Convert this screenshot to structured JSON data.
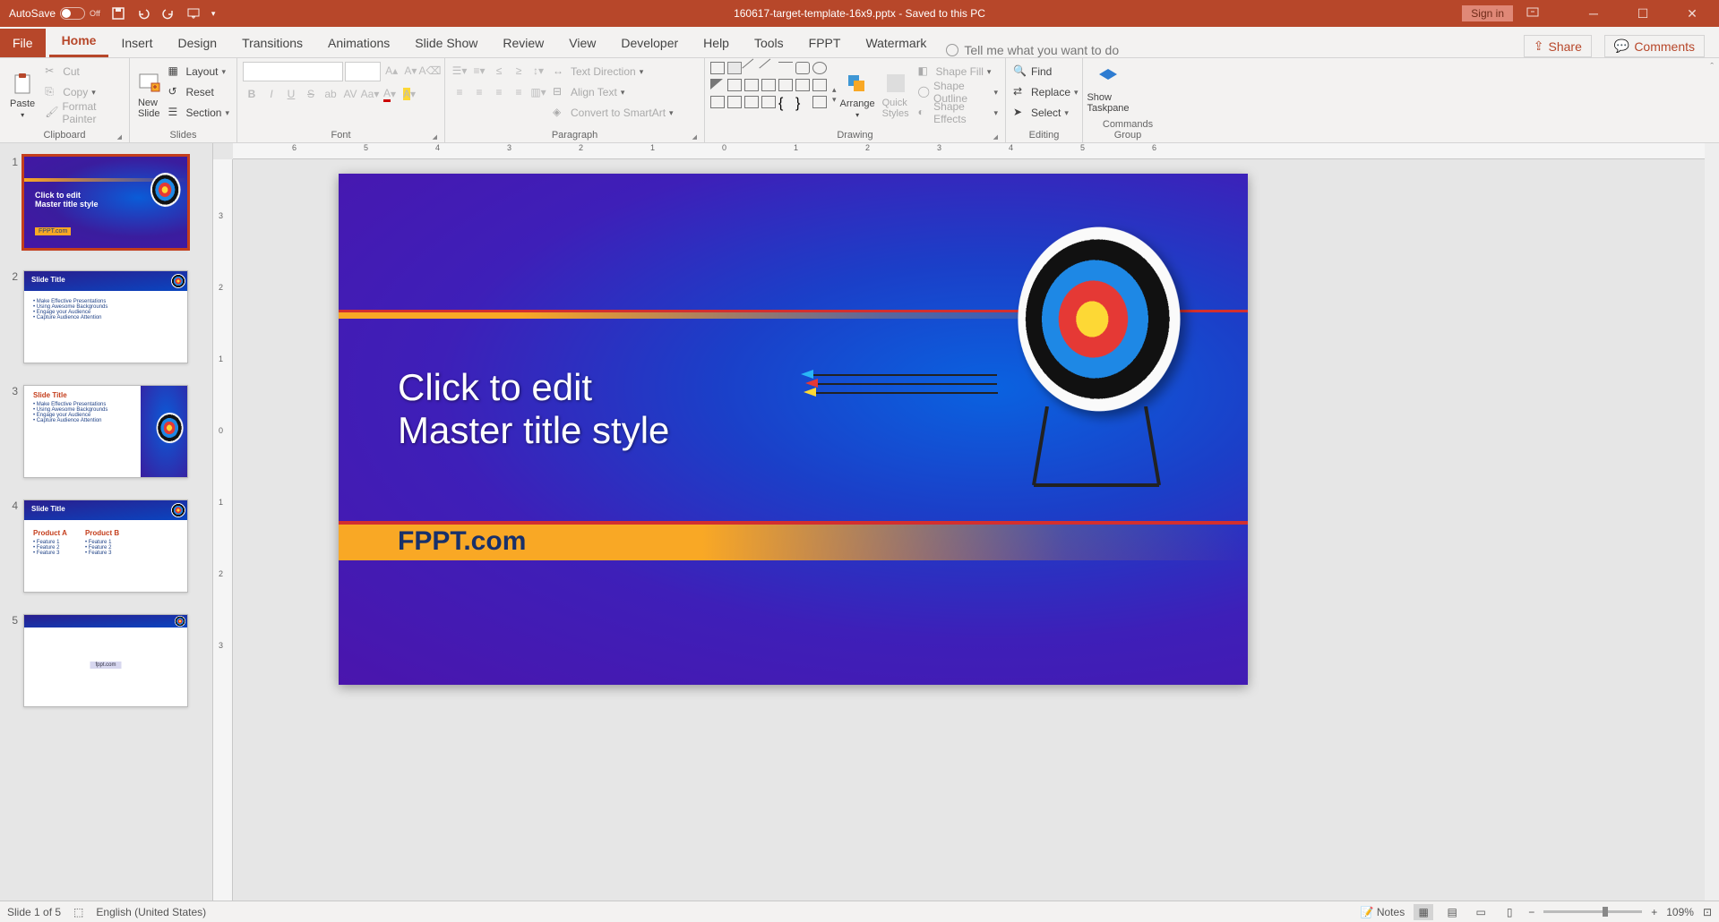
{
  "titlebar": {
    "autosave": "AutoSave",
    "autosave_state": "Off",
    "filename": "160617-target-template-16x9.pptx - Saved to this PC",
    "signin": "Sign in"
  },
  "tabs": {
    "file": "File",
    "items": [
      "Home",
      "Insert",
      "Design",
      "Transitions",
      "Animations",
      "Slide Show",
      "Review",
      "View",
      "Developer",
      "Help",
      "Tools",
      "FPPT",
      "Watermark"
    ],
    "active_index": 0,
    "tellme": "Tell me what you want to do",
    "share": "Share",
    "comments": "Comments"
  },
  "ribbon": {
    "clipboard": {
      "label": "Clipboard",
      "paste": "Paste",
      "cut": "Cut",
      "copy": "Copy",
      "format_painter": "Format Painter"
    },
    "slides": {
      "label": "Slides",
      "new_slide": "New\nSlide",
      "layout": "Layout",
      "reset": "Reset",
      "section": "Section"
    },
    "font": {
      "label": "Font"
    },
    "paragraph": {
      "label": "Paragraph",
      "text_direction": "Text Direction",
      "align_text": "Align Text",
      "convert_smartart": "Convert to SmartArt"
    },
    "drawing": {
      "label": "Drawing",
      "arrange": "Arrange",
      "quick_styles": "Quick\nStyles",
      "shape_fill": "Shape Fill",
      "shape_outline": "Shape Outline",
      "shape_effects": "Shape Effects"
    },
    "editing": {
      "label": "Editing",
      "find": "Find",
      "replace": "Replace",
      "select": "Select"
    },
    "commands": {
      "label": "Commands Group",
      "show_taskpane": "Show\nTaskpane"
    }
  },
  "thumbnails": [
    {
      "n": "1",
      "title": "Click to edit\nMaster title style",
      "brand": "FPPT.com"
    },
    {
      "n": "2",
      "title": "Slide Title",
      "bullets": [
        "Make Effective Presentations",
        "Using Awesome Backgrounds",
        "Engage your Audience",
        "Capture Audience Attention"
      ]
    },
    {
      "n": "3",
      "title": "Slide Title",
      "bullets": [
        "Make Effective Presentations",
        "Using Awesome Backgrounds",
        "Engage your Audience",
        "Capture Audience Attention"
      ]
    },
    {
      "n": "4",
      "title": "Slide Title",
      "cols": [
        {
          "h": "Product A",
          "rows": [
            "Feature 1",
            "Feature 2",
            "Feature 3"
          ]
        },
        {
          "h": "Product B",
          "rows": [
            "Feature 1",
            "Feature 2",
            "Feature 3"
          ]
        }
      ]
    },
    {
      "n": "5",
      "brand": "fppt.com"
    }
  ],
  "slide": {
    "title": "Click to edit\nMaster title style",
    "brand": "FPPT.com"
  },
  "ruler_h": [
    "6",
    "5",
    "4",
    "3",
    "2",
    "1",
    "0",
    "1",
    "2",
    "3",
    "4",
    "5",
    "6"
  ],
  "ruler_v": [
    "3",
    "2",
    "1",
    "0",
    "1",
    "2",
    "3"
  ],
  "statusbar": {
    "slide_info": "Slide 1 of 5",
    "language": "English (United States)",
    "notes": "Notes",
    "zoom": "109%"
  }
}
